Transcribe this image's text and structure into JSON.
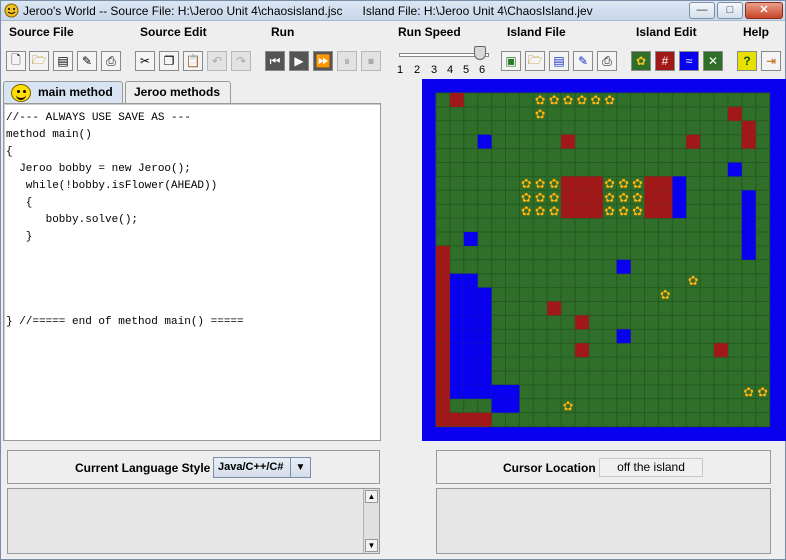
{
  "window": {
    "title": "Jeroo's World -- Source File: H:\\Jeroo Unit 4\\chaosisland.jsc      Island File: H:\\Jeroo Unit 4\\ChaosIsland.jev",
    "controls": {
      "minimize": "—",
      "maximize": "□",
      "close": "✕"
    }
  },
  "menubar": {
    "items": [
      {
        "label": "Source File"
      },
      {
        "label": "Source Edit"
      },
      {
        "label": "Run"
      },
      {
        "label": "Run Speed"
      },
      {
        "label": "Island File"
      },
      {
        "label": "Island Edit"
      },
      {
        "label": "Help"
      }
    ]
  },
  "toolbar": {
    "speed": {
      "ticks": [
        "1",
        "2",
        "3",
        "4",
        "5",
        "6"
      ],
      "value": 6
    }
  },
  "tabs": [
    {
      "label": "main method",
      "selected": true
    },
    {
      "label": "Jeroo methods",
      "selected": false
    }
  ],
  "editor": {
    "code": "//--- ALWAYS USE SAVE AS ---\nmethod main()\n{\n  Jeroo bobby = new Jeroo();\n   while(!bobby.isFlower(AHEAD))\n   {\n      bobby.solve();\n   }\n\n\n\n\n} //===== end of method main() ====="
  },
  "language": {
    "label": "Current Language Style",
    "value": "Java/C++/C#"
  },
  "cursor": {
    "label": "Cursor Location",
    "value": "off the island"
  },
  "island": {
    "colors": {
      "water": "#0a00f0",
      "grass": "#2f6f2a",
      "net": "#a01818",
      "flower": "#f0c020"
    }
  }
}
